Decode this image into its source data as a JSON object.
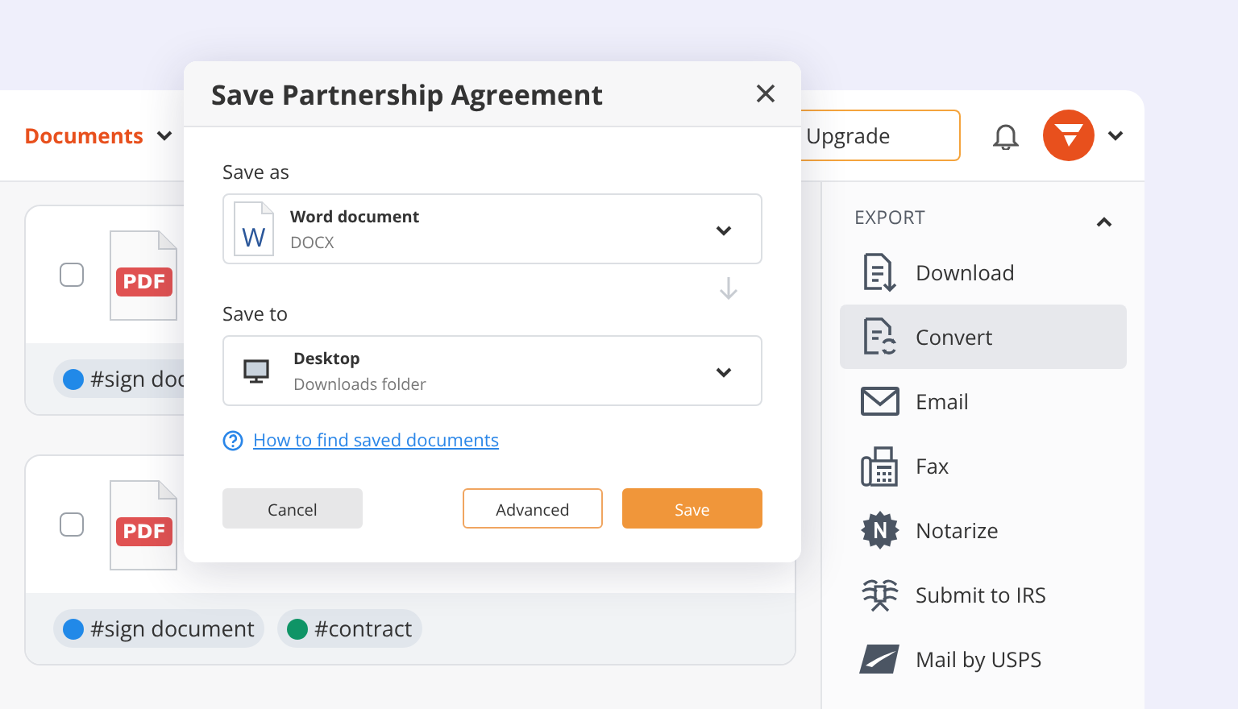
{
  "header": {
    "menu": "Documents",
    "upgrade": "Upgrade"
  },
  "documents": [
    {
      "checked": false,
      "file_type": "PDF",
      "tags": [
        {
          "label": "#sign doc",
          "color": "#2189e8"
        }
      ]
    },
    {
      "checked": false,
      "file_type": "PDF",
      "tags": [
        {
          "label": "#sign document",
          "color": "#2189e8"
        },
        {
          "label": "#contract",
          "color": "#0f9466"
        }
      ]
    }
  ],
  "export": {
    "title": "EXPORT",
    "expanded": true,
    "items": [
      {
        "label": "Download",
        "kind": "download",
        "selected": false
      },
      {
        "label": "Convert",
        "kind": "convert",
        "selected": true
      },
      {
        "label": "Email",
        "kind": "email",
        "selected": false
      },
      {
        "label": "Fax",
        "kind": "fax",
        "selected": false
      },
      {
        "label": "Notarize",
        "kind": "notarize",
        "selected": false
      },
      {
        "label": "Submit to IRS",
        "kind": "irs",
        "selected": false
      },
      {
        "label": "Mail by USPS",
        "kind": "usps",
        "selected": false
      }
    ]
  },
  "dialog": {
    "title": "Save Partnership Agreement",
    "save_as": {
      "label": "Save as",
      "kind": "word",
      "badge": "W",
      "name": "Word document",
      "detail": "DOCX"
    },
    "save_to": {
      "label": "Save to",
      "kind": "desktop",
      "name": "Desktop",
      "detail": "Downloads folder"
    },
    "help_link": "How to find saved documents",
    "buttons": [
      {
        "label": "Cancel",
        "kind": "secondary"
      },
      {
        "label": "Advanced",
        "kind": "outline"
      },
      {
        "label": "Save",
        "kind": "primary"
      }
    ]
  }
}
